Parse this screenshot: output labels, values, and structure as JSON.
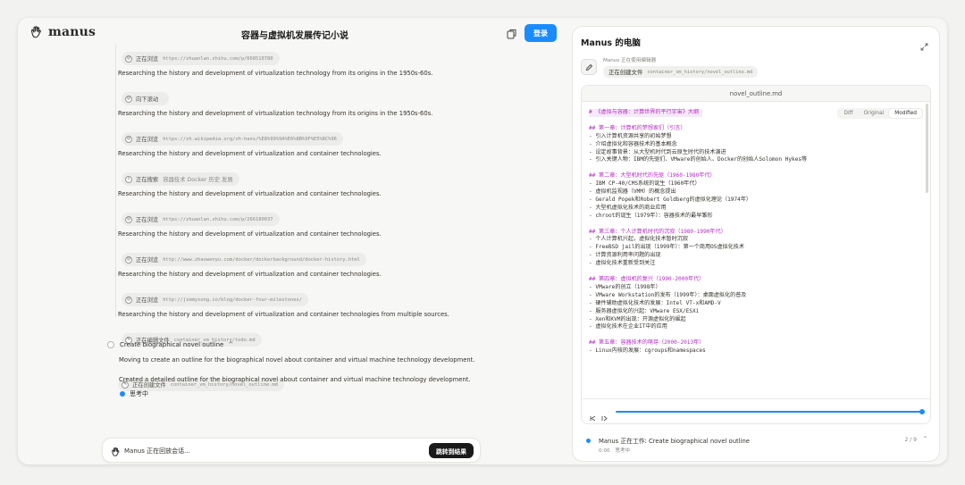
{
  "header": {
    "logo_text": "manus",
    "chat_title": "容器与虚拟机发展传记小说",
    "login_label": "登录"
  },
  "feed": [
    {
      "type": "chip",
      "icon": "globe-icon",
      "label": "正在浏览",
      "detail": "https://zhuanlan.zhihu.com/p/668510780",
      "mono": true
    },
    {
      "type": "text",
      "text": "Researching the history and development of virtualization technology from its origins in the 1950s-60s."
    },
    {
      "type": "chip",
      "icon": "scroll-icon",
      "label": "向下滚动",
      "detail": "",
      "mono": true
    },
    {
      "type": "text",
      "text": "Researching the history and development of virtualization technology from its origins in the 1950s-60s."
    },
    {
      "type": "chip",
      "icon": "globe-icon",
      "label": "正在浏览",
      "detail": "https://zh.wikipedia.org/zh-hans/%E8%99%9A%E6%8B%9F%E5%8C%96",
      "mono": true
    },
    {
      "type": "text",
      "text": "Researching the history and development of virtualization and container technologies."
    },
    {
      "type": "chip",
      "icon": "search-icon",
      "label": "正在搜索",
      "detail": "容器技术 Docker 历史 发展",
      "mono": false
    },
    {
      "type": "text",
      "text": "Researching the history and development of virtualization and container technologies."
    },
    {
      "type": "chip",
      "icon": "globe-icon",
      "label": "正在浏览",
      "detail": "https://zhuanlan.zhihu.com/p/266180037",
      "mono": true
    },
    {
      "type": "text",
      "text": "Researching the history and development of virtualization and container technologies."
    },
    {
      "type": "chip",
      "icon": "globe-icon",
      "label": "正在浏览",
      "detail": "http://www.zhaowenyu.com/docker/dockerbackground/docker-history.html",
      "mono": true
    },
    {
      "type": "text",
      "text": "Researching the history and development of virtualization and container technologies."
    },
    {
      "type": "chip",
      "icon": "globe-icon",
      "label": "正在浏览",
      "detail": "http://jimmysong.io/blog/docker-four-milestones/",
      "mono": true
    },
    {
      "type": "text",
      "text": "Researching the history and development of virtualization and container technologies from multiple sources."
    },
    {
      "type": "chip",
      "icon": "edit-icon",
      "label": "正在编辑文件",
      "detail": "container_vm_history/todo.md",
      "mono": true
    }
  ],
  "step": {
    "title": "Create biographical novel outline",
    "line1": "Moving to create an outline for the biographical novel about container and virtual machine technology development.",
    "chip_label": "正在创建文件",
    "chip_detail": "container_vm_history/novel_outline.md",
    "line2": "Created a detailed outline for the biographical novel about container and virtual machine technology development.",
    "thinking": "思考中"
  },
  "bottom_bar": {
    "text": "Manus 正在回放会话...",
    "jump_label": "跳转到结果"
  },
  "panel": {
    "title": "Manus 的电脑",
    "agent_status": "Manus 正在使用编辑器",
    "agent_action": "正在创建文件",
    "agent_file": "container_vm_history/novel_outline.md",
    "editor_filename": "novel_outline.md",
    "view_tabs": [
      "Diff",
      "Original",
      "Modified"
    ],
    "active_tab": "Modified",
    "progress": 1.0,
    "task_title": "Manus 正在工作: Create biographical novel outline",
    "task_time": "0:00",
    "task_state": "思考中",
    "task_count": "2 / 9"
  },
  "code_lines": [
    {
      "t": "# 《虚拟与容器：计算世界的平行宇宙》大纲",
      "k": "h1"
    },
    {
      "t": "",
      "k": "blank"
    },
    {
      "t": "## 第一章：计算机的梦想家们（引言）",
      "k": "h"
    },
    {
      "t": "- 引入计算机资源共享的初始梦想",
      "k": ""
    },
    {
      "t": "- 介绍虚拟化和容器技术的基本概念",
      "k": ""
    },
    {
      "t": "- 设定故事背景：从大型机时代到云原生时代的技术演进",
      "k": ""
    },
    {
      "t": "- 引入关键人物：IBM的先驱们、VMware的创始人、Docker的创始人Solomon Hykes等",
      "k": ""
    },
    {
      "t": "",
      "k": "blank"
    },
    {
      "t": "## 第二章：大型机时代的先驱（1960-1980年代）",
      "k": "h"
    },
    {
      "t": "- IBM CP-40/CMS系统的诞生（1960年代）",
      "k": ""
    },
    {
      "t": "- 虚拟机监视器（VMM）的概念提出",
      "k": ""
    },
    {
      "t": "- Gerald Popek和Robert Goldberg的虚拟化理论（1974年）",
      "k": ""
    },
    {
      "t": "- 大型机虚拟化技术的商业应用",
      "k": ""
    },
    {
      "t": "- chroot的诞生（1979年）：容器技术的最早雏形",
      "k": ""
    },
    {
      "t": "",
      "k": "blank"
    },
    {
      "t": "## 第三章：个人计算机时代的沉寂（1980-1990年代）",
      "k": "h"
    },
    {
      "t": "- 个人计算机兴起，虚拟化技术暂时沉寂",
      "k": ""
    },
    {
      "t": "- FreeBSD jail的出现（1999年）：第一个商用OS虚拟化技术",
      "k": ""
    },
    {
      "t": "- 计算资源利用率问题的出现",
      "k": ""
    },
    {
      "t": "- 虚拟化技术重新受到关注",
      "k": ""
    },
    {
      "t": "",
      "k": "blank"
    },
    {
      "t": "## 第四章：虚拟机的复兴（1990-2000年代）",
      "k": "h"
    },
    {
      "t": "- VMware的创立（1998年）",
      "k": ""
    },
    {
      "t": "- VMware Workstation的发布（1999年）：桌面虚拟化的普及",
      "k": ""
    },
    {
      "t": "- 硬件辅助虚拟化技术的发展：Intel VT-x和AMD-V",
      "k": ""
    },
    {
      "t": "- 服务器虚拟化的兴起：VMware ESX/ESXi",
      "k": ""
    },
    {
      "t": "- Xen和KVM的出现：开源虚拟化的崛起",
      "k": ""
    },
    {
      "t": "- 虚拟化技术在企业IT中的应用",
      "k": ""
    },
    {
      "t": "",
      "k": "blank"
    },
    {
      "t": "## 第五章：容器技术的萌芽（2000-2013年）",
      "k": "h"
    },
    {
      "t": "- Linux内核的发展：cgroups和namespaces",
      "k": ""
    }
  ]
}
